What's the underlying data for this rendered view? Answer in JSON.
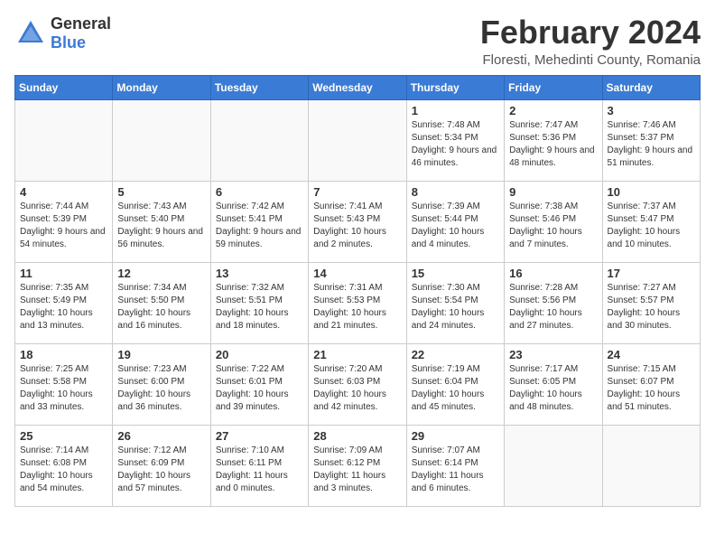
{
  "header": {
    "logo_line1": "General",
    "logo_line2": "Blue",
    "month_title": "February 2024",
    "location": "Floresti, Mehedinti County, Romania"
  },
  "weekdays": [
    "Sunday",
    "Monday",
    "Tuesday",
    "Wednesday",
    "Thursday",
    "Friday",
    "Saturday"
  ],
  "weeks": [
    [
      {
        "day": "",
        "info": ""
      },
      {
        "day": "",
        "info": ""
      },
      {
        "day": "",
        "info": ""
      },
      {
        "day": "",
        "info": ""
      },
      {
        "day": "1",
        "info": "Sunrise: 7:48 AM\nSunset: 5:34 PM\nDaylight: 9 hours\nand 46 minutes."
      },
      {
        "day": "2",
        "info": "Sunrise: 7:47 AM\nSunset: 5:36 PM\nDaylight: 9 hours\nand 48 minutes."
      },
      {
        "day": "3",
        "info": "Sunrise: 7:46 AM\nSunset: 5:37 PM\nDaylight: 9 hours\nand 51 minutes."
      }
    ],
    [
      {
        "day": "4",
        "info": "Sunrise: 7:44 AM\nSunset: 5:39 PM\nDaylight: 9 hours\nand 54 minutes."
      },
      {
        "day": "5",
        "info": "Sunrise: 7:43 AM\nSunset: 5:40 PM\nDaylight: 9 hours\nand 56 minutes."
      },
      {
        "day": "6",
        "info": "Sunrise: 7:42 AM\nSunset: 5:41 PM\nDaylight: 9 hours\nand 59 minutes."
      },
      {
        "day": "7",
        "info": "Sunrise: 7:41 AM\nSunset: 5:43 PM\nDaylight: 10 hours\nand 2 minutes."
      },
      {
        "day": "8",
        "info": "Sunrise: 7:39 AM\nSunset: 5:44 PM\nDaylight: 10 hours\nand 4 minutes."
      },
      {
        "day": "9",
        "info": "Sunrise: 7:38 AM\nSunset: 5:46 PM\nDaylight: 10 hours\nand 7 minutes."
      },
      {
        "day": "10",
        "info": "Sunrise: 7:37 AM\nSunset: 5:47 PM\nDaylight: 10 hours\nand 10 minutes."
      }
    ],
    [
      {
        "day": "11",
        "info": "Sunrise: 7:35 AM\nSunset: 5:49 PM\nDaylight: 10 hours\nand 13 minutes."
      },
      {
        "day": "12",
        "info": "Sunrise: 7:34 AM\nSunset: 5:50 PM\nDaylight: 10 hours\nand 16 minutes."
      },
      {
        "day": "13",
        "info": "Sunrise: 7:32 AM\nSunset: 5:51 PM\nDaylight: 10 hours\nand 18 minutes."
      },
      {
        "day": "14",
        "info": "Sunrise: 7:31 AM\nSunset: 5:53 PM\nDaylight: 10 hours\nand 21 minutes."
      },
      {
        "day": "15",
        "info": "Sunrise: 7:30 AM\nSunset: 5:54 PM\nDaylight: 10 hours\nand 24 minutes."
      },
      {
        "day": "16",
        "info": "Sunrise: 7:28 AM\nSunset: 5:56 PM\nDaylight: 10 hours\nand 27 minutes."
      },
      {
        "day": "17",
        "info": "Sunrise: 7:27 AM\nSunset: 5:57 PM\nDaylight: 10 hours\nand 30 minutes."
      }
    ],
    [
      {
        "day": "18",
        "info": "Sunrise: 7:25 AM\nSunset: 5:58 PM\nDaylight: 10 hours\nand 33 minutes."
      },
      {
        "day": "19",
        "info": "Sunrise: 7:23 AM\nSunset: 6:00 PM\nDaylight: 10 hours\nand 36 minutes."
      },
      {
        "day": "20",
        "info": "Sunrise: 7:22 AM\nSunset: 6:01 PM\nDaylight: 10 hours\nand 39 minutes."
      },
      {
        "day": "21",
        "info": "Sunrise: 7:20 AM\nSunset: 6:03 PM\nDaylight: 10 hours\nand 42 minutes."
      },
      {
        "day": "22",
        "info": "Sunrise: 7:19 AM\nSunset: 6:04 PM\nDaylight: 10 hours\nand 45 minutes."
      },
      {
        "day": "23",
        "info": "Sunrise: 7:17 AM\nSunset: 6:05 PM\nDaylight: 10 hours\nand 48 minutes."
      },
      {
        "day": "24",
        "info": "Sunrise: 7:15 AM\nSunset: 6:07 PM\nDaylight: 10 hours\nand 51 minutes."
      }
    ],
    [
      {
        "day": "25",
        "info": "Sunrise: 7:14 AM\nSunset: 6:08 PM\nDaylight: 10 hours\nand 54 minutes."
      },
      {
        "day": "26",
        "info": "Sunrise: 7:12 AM\nSunset: 6:09 PM\nDaylight: 10 hours\nand 57 minutes."
      },
      {
        "day": "27",
        "info": "Sunrise: 7:10 AM\nSunset: 6:11 PM\nDaylight: 11 hours\nand 0 minutes."
      },
      {
        "day": "28",
        "info": "Sunrise: 7:09 AM\nSunset: 6:12 PM\nDaylight: 11 hours\nand 3 minutes."
      },
      {
        "day": "29",
        "info": "Sunrise: 7:07 AM\nSunset: 6:14 PM\nDaylight: 11 hours\nand 6 minutes."
      },
      {
        "day": "",
        "info": ""
      },
      {
        "day": "",
        "info": ""
      }
    ]
  ]
}
